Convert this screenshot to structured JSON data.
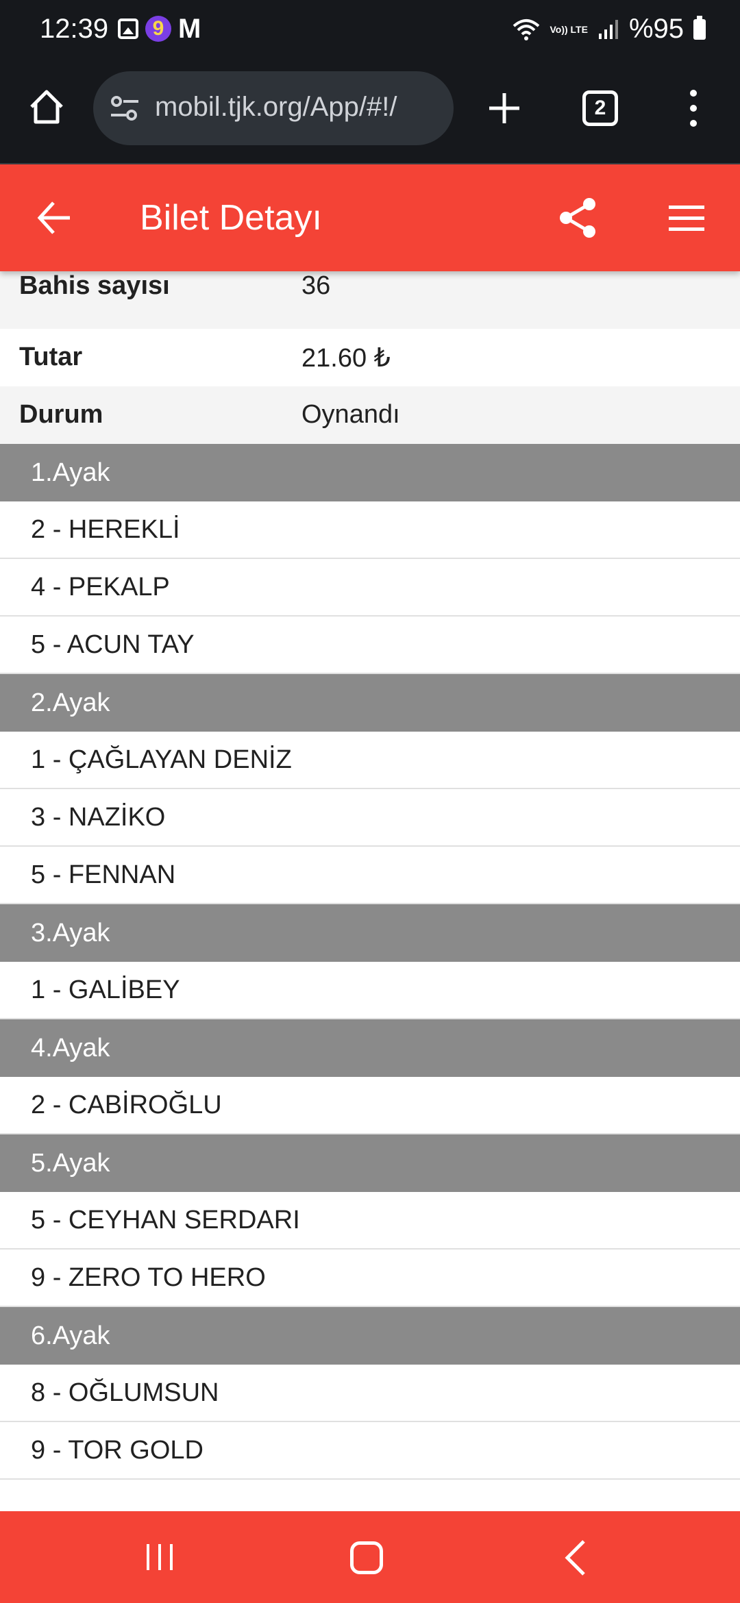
{
  "status_bar": {
    "time": "12:39",
    "battery": "%95",
    "volte": "Vo)) LTE",
    "notification_letter": "M",
    "notification_badge": "9"
  },
  "browser": {
    "url": "mobil.tjk.org/App/#!/",
    "tab_count": "2"
  },
  "header": {
    "title": "Bilet Detayı",
    "color": "#f44336"
  },
  "info": [
    {
      "label": "Bahis sayısı",
      "value": "36"
    },
    {
      "label": "Tutar",
      "value": "21.60 ₺"
    },
    {
      "label": "Durum",
      "value": "Oynandı"
    }
  ],
  "legs": [
    {
      "title": "1.Ayak",
      "horses": [
        "2 - HEREKLİ",
        "4 - PEKALP",
        "5 - ACUN TAY"
      ]
    },
    {
      "title": "2.Ayak",
      "horses": [
        "1 - ÇAĞLAYAN DENİZ",
        "3 - NAZİKO",
        "5 - FENNAN"
      ]
    },
    {
      "title": "3.Ayak",
      "horses": [
        "1 - GALİBEY"
      ]
    },
    {
      "title": "4.Ayak",
      "horses": [
        "2 - CABİROĞLU"
      ]
    },
    {
      "title": "5.Ayak",
      "horses": [
        "5 - CEYHAN SERDARI",
        "9 - ZERO TO HERO"
      ]
    },
    {
      "title": "6.Ayak",
      "horses": [
        "8 - OĞLUMSUN",
        "9 - TOR GOLD"
      ]
    }
  ],
  "icons": {
    "home": "home-icon",
    "site_settings": "tune-icon",
    "new_tab": "plus-icon",
    "tab_switcher": "tabs-icon",
    "browser_menu": "more-vert-icon",
    "back": "arrow-left-icon",
    "share": "share-icon",
    "menu": "hamburger-menu-icon"
  }
}
